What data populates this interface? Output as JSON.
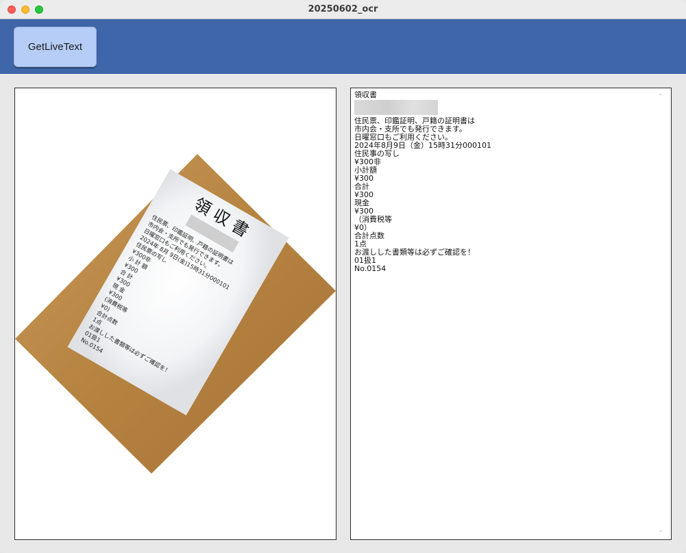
{
  "window": {
    "title": "20250602_ocr"
  },
  "toolbar": {
    "button_label": "GetLiveText"
  },
  "receipt": {
    "title": "領 収 書",
    "lines": [
      "住民票、印鑑証明、戸籍の証明書は",
      "市内会・支所でも発行できます。",
      "日曜窓口もご利用ください。",
      "2024年 8月 9日(金)15時31分000101",
      "住民票の写し",
      "¥300非",
      "小 計 額",
      "¥300",
      "合 計",
      "¥300",
      "現 金",
      "¥300",
      "(消費税等",
      "¥0)",
      "合計点数",
      "1点",
      "お渡しした書類等は必ずご確認を！",
      "01扱1",
      "No.0154"
    ]
  },
  "ocr": {
    "lines_before_blur": [
      "領収書"
    ],
    "lines": [
      "住民票、印鑑証明、戸籍の証明書は",
      "市内会・支所でも発行できます。",
      "日曜窓口もご利用ください。",
      "2024年8月9日（金）15時31分000101",
      "住民事の写し",
      "¥300非",
      "小計額",
      "¥300",
      "合計",
      "¥300",
      "現金",
      "¥300",
      "（消費税等",
      "¥0）",
      "合計点数",
      "1点",
      "お渡しした書類等は必ずご確認を！",
      "01扱1",
      "No.0154"
    ]
  },
  "icons": {
    "scroll_up": "chevron-up-icon",
    "scroll_down": "chevron-down-icon"
  },
  "colors": {
    "toolbar": "#3e66a8",
    "button": "#b6cdf7",
    "wood": "#b8864a"
  }
}
